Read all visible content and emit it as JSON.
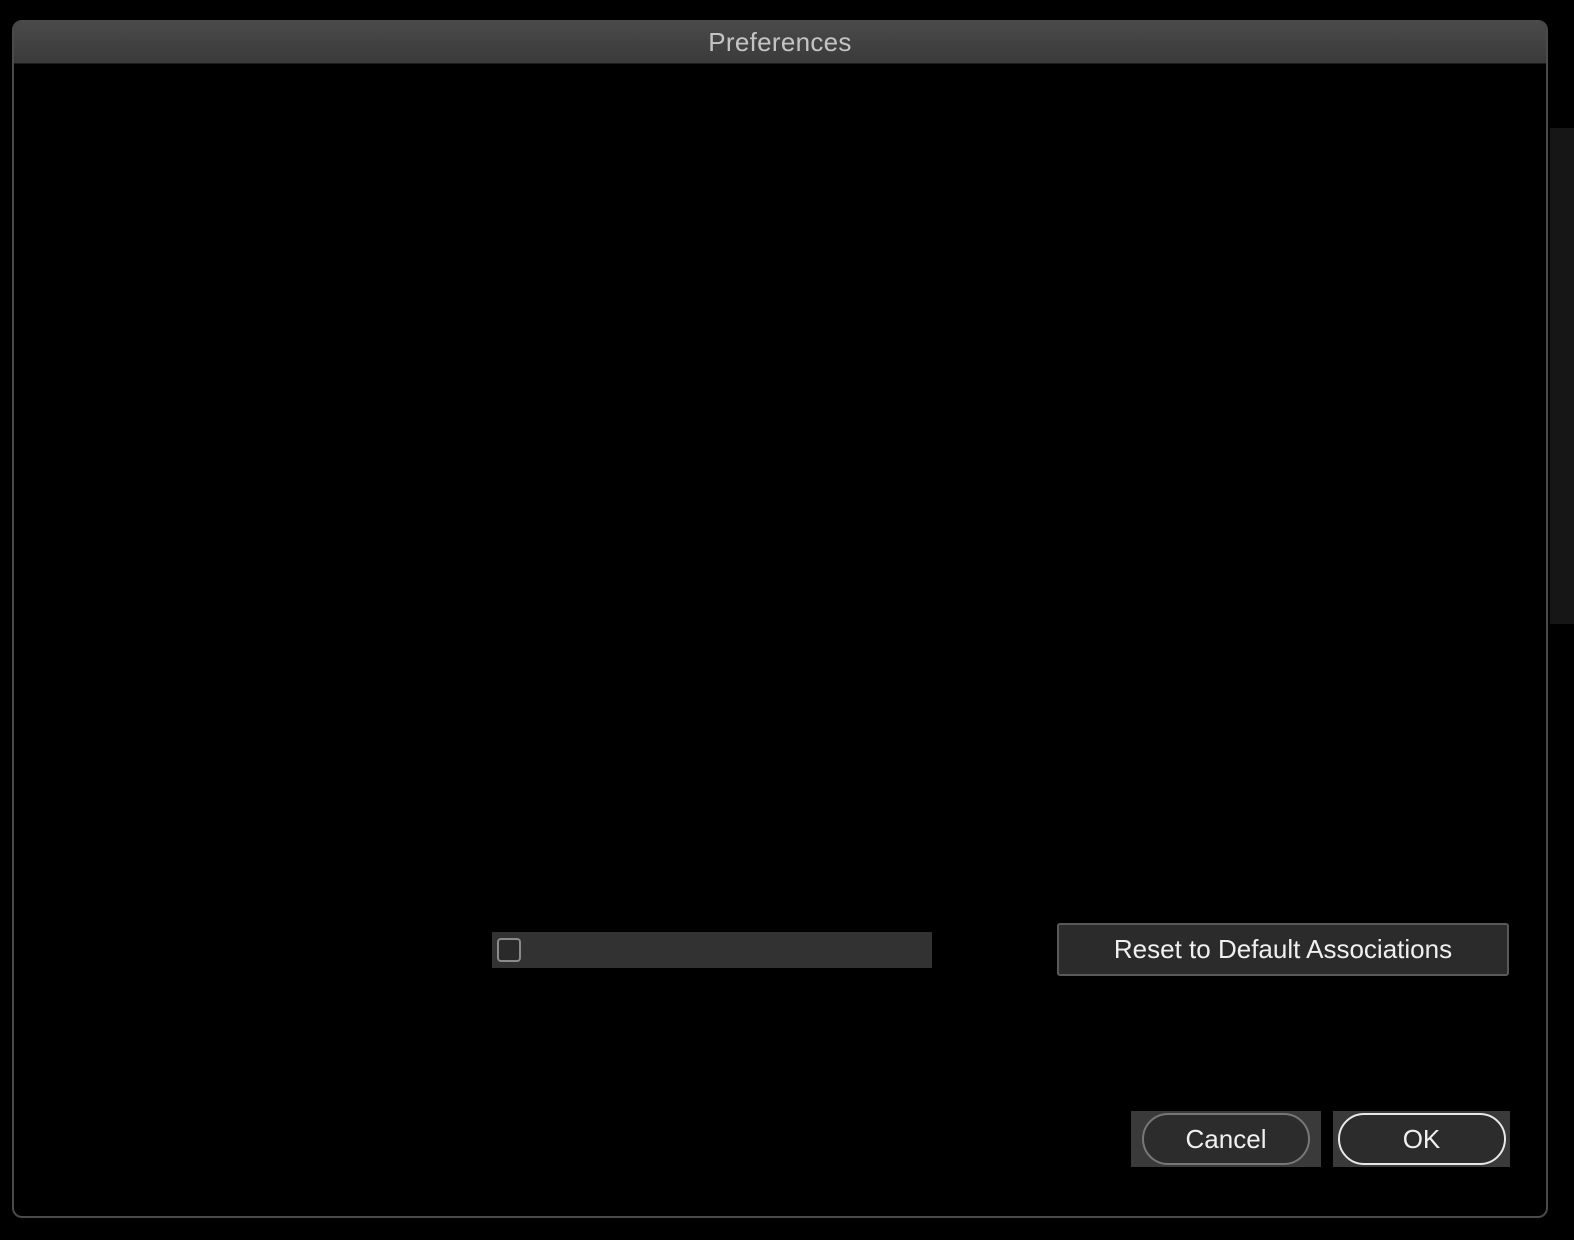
{
  "window": {
    "title": "Preferences"
  },
  "options": {
    "checkbox_checked": false,
    "reset_label": "Reset to Default Associations"
  },
  "footer": {
    "cancel_label": "Cancel",
    "ok_label": "OK"
  }
}
